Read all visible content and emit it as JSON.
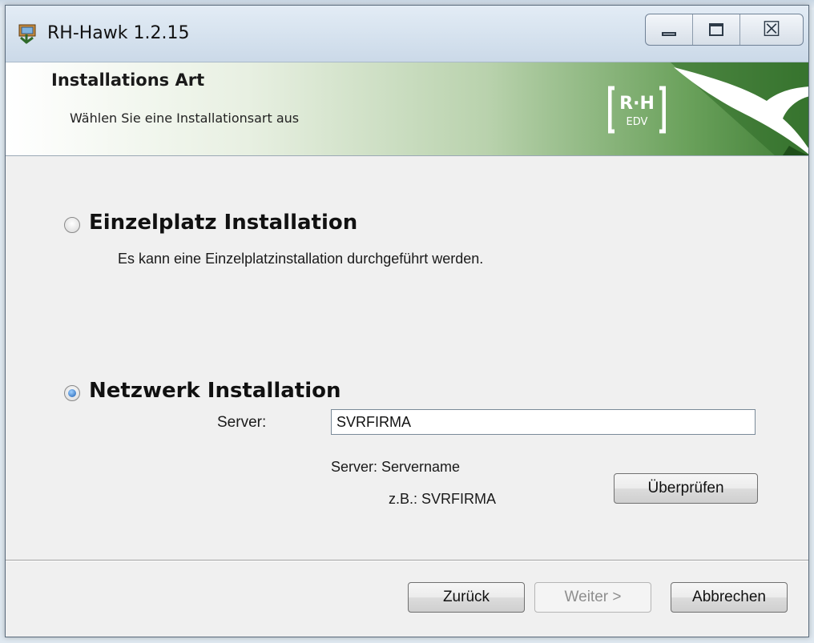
{
  "window": {
    "title": "RH-Hawk 1.2.15",
    "caption_buttons": {
      "minimize_icon": "minimize-icon",
      "maximize_icon": "maximize-icon",
      "close_glyph": "☒"
    }
  },
  "banner": {
    "title": "Installations Art",
    "subtitle": "Wählen Sie eine Installationsart aus",
    "logo_text_top": "R·H",
    "logo_text_bottom": "EDV"
  },
  "options": [
    {
      "label": "Einzelplatz Installation",
      "description": "Es kann eine Einzelplatzinstallation durchgeführt werden.",
      "selected": false
    },
    {
      "label": "Netzwerk Installation",
      "selected": true
    }
  ],
  "server": {
    "label": "Server:",
    "value": "SVRFIRMA",
    "hint_line1": "Server: Servername",
    "hint_line2": "z.B.: SVRFIRMA",
    "check_button": "Überprüfen"
  },
  "footer": {
    "back_button": "Zurück",
    "next_button": "Weiter >",
    "cancel_button": "Abbrechen"
  },
  "colors": {
    "banner_accent": "#3f7d35",
    "radio_selected": "#1c5fb3"
  }
}
